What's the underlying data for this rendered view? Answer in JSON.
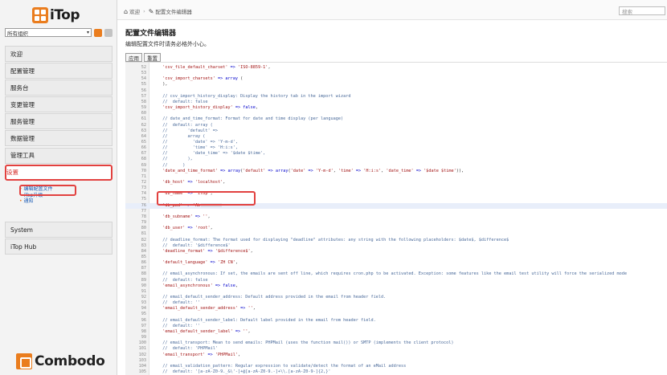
{
  "brand": {
    "name": "iTop",
    "footer": "Combodo"
  },
  "org_select": {
    "value": "所有组织"
  },
  "menu": [
    "欢迎",
    "配置管理",
    "服务台",
    "变更管理",
    "服务管理",
    "数据管理",
    "管理工具",
    "设置"
  ],
  "submenu": [
    "编辑配置文件",
    "iTop升级",
    "通知"
  ],
  "menu_bottom": [
    "System",
    "iTop Hub"
  ],
  "breadcrumb": {
    "home": "欢迎",
    "current": "配置文件编辑器"
  },
  "search": {
    "placeholder": "搜索"
  },
  "page": {
    "title": "配置文件编辑器",
    "description": "编辑配置文件时请务必格外小心。",
    "apply_label": "应用",
    "reset_label": "重置"
  },
  "code_lines": [
    {
      "n": "52",
      "t": "  'csv_file_default_charset' => 'ISO-8859-1',"
    },
    {
      "n": "53",
      "t": ""
    },
    {
      "n": "54",
      "t": "  'csv_import_charsets' => array ("
    },
    {
      "n": "55",
      "t": "  ),"
    },
    {
      "n": "56",
      "t": ""
    },
    {
      "n": "57",
      "t": "  // csv_import_history_display: Display the history tab in the import wizard"
    },
    {
      "n": "58",
      "t": "  //  default: false"
    },
    {
      "n": "59",
      "t": "  'csv_import_history_display' => false,"
    },
    {
      "n": "60",
      "t": ""
    },
    {
      "n": "61",
      "t": "  // date_and_time_format: Format for date and time display (per language)"
    },
    {
      "n": "62",
      "t": "  //  default: array ("
    },
    {
      "n": "63",
      "t": "  //        'default' =>"
    },
    {
      "n": "64",
      "t": "  //        array ("
    },
    {
      "n": "65",
      "t": "  //          'date' => 'Y-m-d',"
    },
    {
      "n": "66",
      "t": "  //          'time' => 'H:i:s',"
    },
    {
      "n": "67",
      "t": "  //          'date_time' => '$date $time',"
    },
    {
      "n": "68",
      "t": "  //        ),"
    },
    {
      "n": "69",
      "t": "  //      )"
    },
    {
      "n": "70",
      "t": "  'date_and_time_format' => array('default' => array('date' => 'Y-m-d', 'time' => 'H:i:s', 'date_time' => '$date $time')),"
    },
    {
      "n": "71",
      "t": ""
    },
    {
      "n": "72",
      "t": "  'db_host' => 'localhost',"
    },
    {
      "n": "73",
      "t": ""
    },
    {
      "n": "74",
      "t": "  'db_name' => 'itop',"
    },
    {
      "n": "75",
      "t": ""
    },
    {
      "n": "76",
      "t": "  'db_pwd' => 'Ab"
    },
    {
      "n": "77",
      "t": ""
    },
    {
      "n": "78",
      "t": "  'db_subname' => '',"
    },
    {
      "n": "79",
      "t": ""
    },
    {
      "n": "80",
      "t": "  'db_user' => 'root',"
    },
    {
      "n": "81",
      "t": ""
    },
    {
      "n": "82",
      "t": "  // deadline_format: The format used for displaying \"deadline\" attributes: any string with the following placeholders: $date$, $difference$"
    },
    {
      "n": "83",
      "t": "  //  default: '$difference$'"
    },
    {
      "n": "84",
      "t": "  'deadline_format' => '$difference$',"
    },
    {
      "n": "85",
      "t": ""
    },
    {
      "n": "86",
      "t": "  'default_language' => 'ZH CN',"
    },
    {
      "n": "87",
      "t": ""
    },
    {
      "n": "88",
      "t": "  // email_asynchronous: If set, the emails are sent off line, which requires cron.php to be activated. Exception: some features like the email test utility will force the serialized mode"
    },
    {
      "n": "89",
      "t": "  //  default: false"
    },
    {
      "n": "90",
      "t": "  'email_asynchronous' => false,"
    },
    {
      "n": "91",
      "t": ""
    },
    {
      "n": "92",
      "t": "  // email_default_sender_address: Default address provided in the email from header field."
    },
    {
      "n": "93",
      "t": "  //  default: ''"
    },
    {
      "n": "94",
      "t": "  'email_default_sender_address' => '',"
    },
    {
      "n": "95",
      "t": ""
    },
    {
      "n": "96",
      "t": "  // email_default_sender_label: Default label provided in the email from header field."
    },
    {
      "n": "97",
      "t": "  //  default: ''"
    },
    {
      "n": "98",
      "t": "  'email_default_sender_label' => '',"
    },
    {
      "n": "99",
      "t": ""
    },
    {
      "n": "100",
      "t": "  // email_transport: Mean to send emails: PHPMail (uses the function mail()) or SMTP (implements the client protocol)"
    },
    {
      "n": "101",
      "t": "  //  default: 'PHPMail'"
    },
    {
      "n": "102",
      "t": "  'email_transport' => 'PHPMail',"
    },
    {
      "n": "103",
      "t": ""
    },
    {
      "n": "104",
      "t": "  // email_validation_pattern: Regular expression to validate/detect the format of an eMail address"
    },
    {
      "n": "105",
      "t": "  //  default: '[a-zA-Z0-9._&\\'-]+@[a-zA-Z0-9.-]+\\\\.[a-zA-Z0-9-]{2,}'"
    },
    {
      "n": "106",
      "t": "  'email_validation_pattern' => '[a-zA-Z0-9._&\\'-]+@[a-zA-Z0-9.-]+\\\\.[a-zA-Z0-9-]{2,}',"
    },
    {
      "n": "107",
      "t": ""
    }
  ],
  "colors": {
    "accent": "#ea7d1e",
    "highlight": "#e2413f",
    "string": "#a31515",
    "comment": "#4a6a9a",
    "key": "#a31515",
    "keyword": "#0000cc"
  }
}
